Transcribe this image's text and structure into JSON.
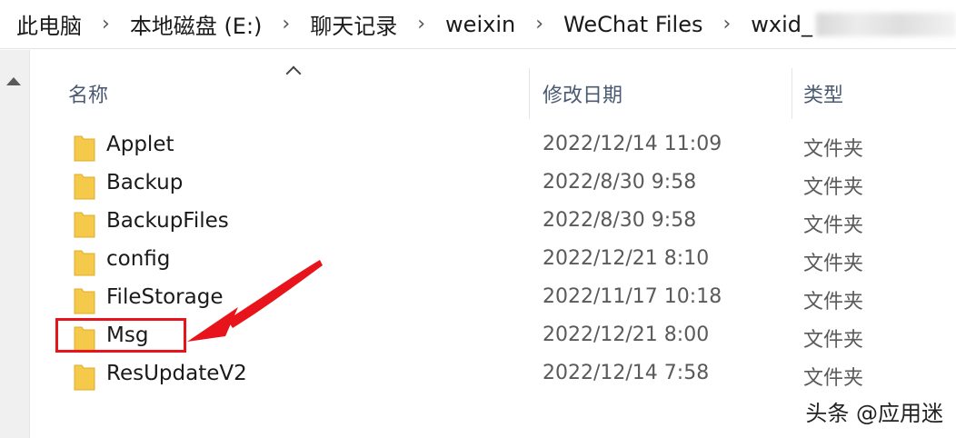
{
  "breadcrumb": {
    "items": [
      "此电脑",
      "本地磁盘 (E:)",
      "聊天记录",
      "weixin",
      "WeChat Files",
      "wxid_"
    ],
    "separator": "›"
  },
  "columns": {
    "name": "名称",
    "date": "修改日期",
    "type": "类型"
  },
  "files": [
    {
      "name": "Applet",
      "date": "2022/12/14 11:09",
      "type": "文件夹"
    },
    {
      "name": "Backup",
      "date": "2022/8/30 9:58",
      "type": "文件夹"
    },
    {
      "name": "BackupFiles",
      "date": "2022/8/30 9:58",
      "type": "文件夹"
    },
    {
      "name": "config",
      "date": "2022/12/21 8:10",
      "type": "文件夹"
    },
    {
      "name": "FileStorage",
      "date": "2022/11/17 10:18",
      "type": "文件夹"
    },
    {
      "name": "Msg",
      "date": "2022/12/21 8:00",
      "type": "文件夹"
    },
    {
      "name": "ResUpdateV2",
      "date": "2022/12/14 7:58",
      "type": "文件夹"
    }
  ],
  "colors": {
    "annotation": "#e8141b",
    "folder": "#f5c94a"
  },
  "watermark": "头条 @应用迷"
}
